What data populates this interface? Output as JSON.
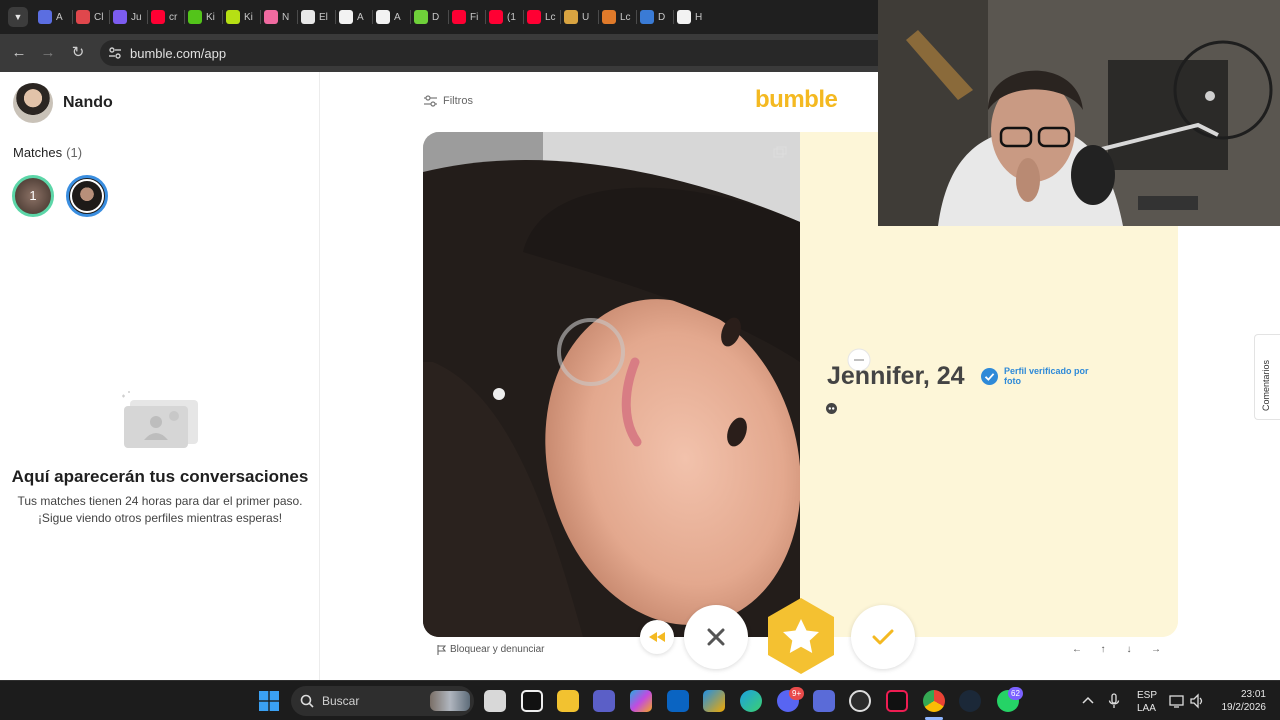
{
  "browser": {
    "tabs": [
      {
        "label": "A",
        "color": "#5b6ee1"
      },
      {
        "label": "Cl",
        "color": "#e0474c"
      },
      {
        "label": "Ju",
        "color": "#7c5cf0"
      },
      {
        "label": "cr",
        "color": "#ff0033"
      },
      {
        "label": "Ki",
        "color": "#53c41a"
      },
      {
        "label": "Ki",
        "color": "#b6e014"
      },
      {
        "label": "N",
        "color": "#f06aa0"
      },
      {
        "label": "El",
        "color": "#e8e8e8"
      },
      {
        "label": "A",
        "color": "#f2f2f2"
      },
      {
        "label": "A",
        "color": "#f2f2f2"
      },
      {
        "label": "D",
        "color": "#6fd13a"
      },
      {
        "label": "Fi",
        "color": "#ff0033"
      },
      {
        "label": "(1",
        "color": "#ff0033"
      },
      {
        "label": "Lc",
        "color": "#ff0033"
      },
      {
        "label": "U",
        "color": "#d9a441"
      },
      {
        "label": "Lc",
        "color": "#e07a2a"
      },
      {
        "label": "D",
        "color": "#3a7bd5"
      },
      {
        "label": "H",
        "color": "#f2f2f2"
      }
    ],
    "url": "bumble.com/app"
  },
  "sidebar": {
    "user_name": "Nando",
    "matches_label": "Matches",
    "matches_count": "(1)",
    "match_badge": "1",
    "empty_title": "Aquí aparecerán tus conversaciones",
    "empty_subtitle": "Tus matches tienen 24 horas para dar el primer paso. ¡Sigue viendo otros perfiles mientras esperas!"
  },
  "main": {
    "filters_label": "Filtros",
    "logo": "bumble",
    "profile": {
      "name": "Jennifer, 24",
      "verified_label": "Perfil verificado por foto"
    },
    "report_label": "Bloquear y denunciar",
    "shortcut_keys": [
      "←",
      "↑",
      "↓",
      "→"
    ],
    "feedback_label": "Comentarios"
  },
  "taskbar": {
    "search_placeholder": "Buscar",
    "discord_badge": "9+",
    "whatsapp_badge": "62",
    "lang_top": "ESP",
    "lang_bottom": "LAA",
    "time": "23:01",
    "date": "19/2/2026"
  },
  "colors": {
    "brand_yellow": "#f4b921",
    "info_panel": "#fdf6d8",
    "verified_blue": "#2e8ad8"
  }
}
